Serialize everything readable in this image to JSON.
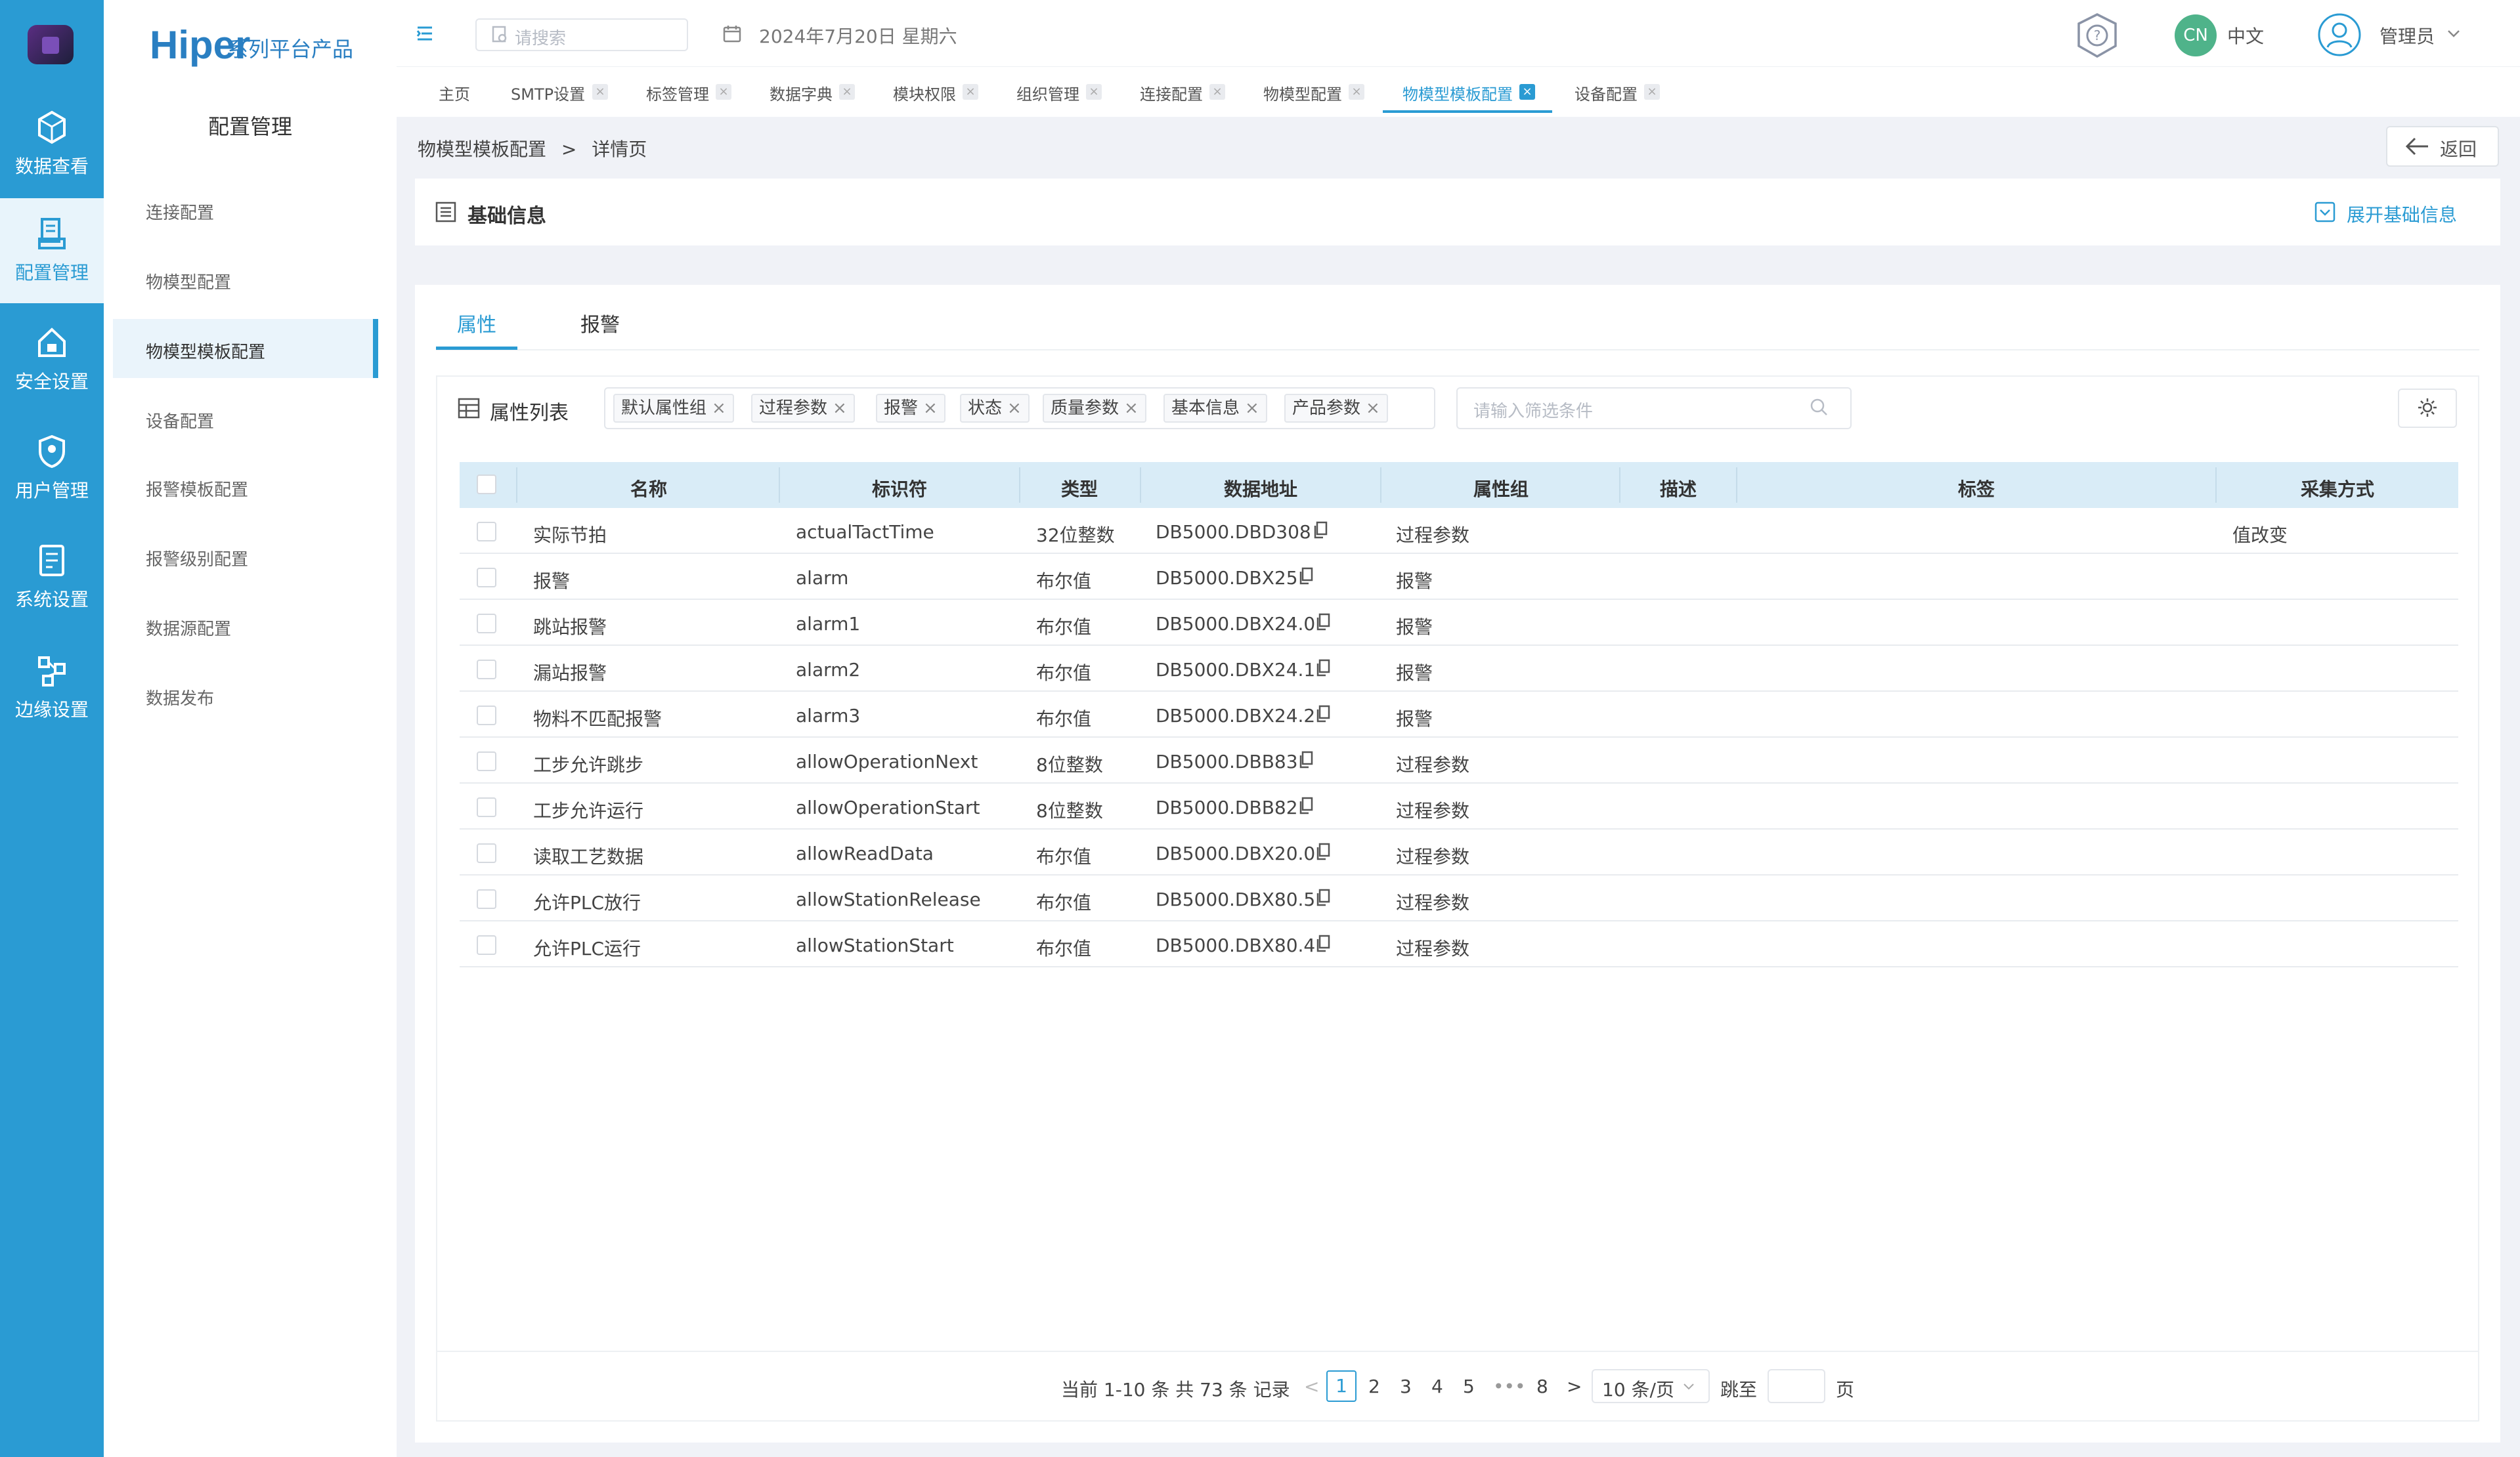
{
  "rail": {
    "items": [
      {
        "label": "数据查看",
        "icon": "cube-icon",
        "active": false
      },
      {
        "label": "配置管理",
        "icon": "config-icon",
        "active": true
      },
      {
        "label": "安全设置",
        "icon": "house-lock-icon",
        "active": false
      },
      {
        "label": "用户管理",
        "icon": "user-shield-icon",
        "active": false
      },
      {
        "label": "系统设置",
        "icon": "settings-doc-icon",
        "active": false
      },
      {
        "label": "边缘设置",
        "icon": "edge-nodes-icon",
        "active": false
      }
    ]
  },
  "brand": {
    "name": "Hiper",
    "suffix": "系列平台产品"
  },
  "sidebar": {
    "title": "配置管理",
    "items": [
      {
        "label": "连接配置"
      },
      {
        "label": "物模型配置"
      },
      {
        "label": "物模型模板配置",
        "active": true
      },
      {
        "label": "设备配置"
      },
      {
        "label": "报警模板配置"
      },
      {
        "label": "报警级别配置"
      },
      {
        "label": "数据源配置"
      },
      {
        "label": "数据发布"
      }
    ]
  },
  "header": {
    "search_placeholder": "请搜索",
    "date": "2024年7月20日 星期六",
    "lang_badge": "CN",
    "lang": "中文",
    "user": "管理员"
  },
  "tabs": [
    {
      "label": "主页",
      "closable": false
    },
    {
      "label": "SMTP设置",
      "closable": true
    },
    {
      "label": "标签管理",
      "closable": true
    },
    {
      "label": "数据字典",
      "closable": true
    },
    {
      "label": "模块权限",
      "closable": true
    },
    {
      "label": "组织管理",
      "closable": true
    },
    {
      "label": "连接配置",
      "closable": true
    },
    {
      "label": "物模型配置",
      "closable": true
    },
    {
      "label": "物模型模板配置",
      "closable": true,
      "active": true
    },
    {
      "label": "设备配置",
      "closable": true
    }
  ],
  "breadcrumb": {
    "parent": "物模型模板配置",
    "sep": ">",
    "current": "详情页"
  },
  "back_label": "返回",
  "basic": {
    "title": "基础信息",
    "expand_label": "展开基础信息"
  },
  "main_tabs": [
    {
      "label": "属性",
      "active": true
    },
    {
      "label": "报警",
      "active": false
    }
  ],
  "list": {
    "title": "属性列表",
    "filters": [
      "默认属性组",
      "过程参数",
      "报警",
      "状态",
      "质量参数",
      "基本信息",
      "产品参数"
    ],
    "condition_placeholder": "请输入筛选条件",
    "columns": [
      "名称",
      "标识符",
      "类型",
      "数据地址",
      "属性组",
      "描述",
      "标签",
      "采集方式"
    ],
    "rows": [
      {
        "name": "实际节拍",
        "id": "actualTactTime",
        "type": "32位整数",
        "addr": "DB5000.DBD308",
        "group": "过程参数",
        "desc": "",
        "tag": "",
        "mode": "值改变"
      },
      {
        "name": "报警",
        "id": "alarm",
        "type": "布尔值",
        "addr": "DB5000.DBX25",
        "group": "报警",
        "desc": "",
        "tag": "",
        "mode": ""
      },
      {
        "name": "跳站报警",
        "id": "alarm1",
        "type": "布尔值",
        "addr": "DB5000.DBX24.0",
        "group": "报警",
        "desc": "",
        "tag": "",
        "mode": ""
      },
      {
        "name": "漏站报警",
        "id": "alarm2",
        "type": "布尔值",
        "addr": "DB5000.DBX24.1",
        "group": "报警",
        "desc": "",
        "tag": "",
        "mode": ""
      },
      {
        "name": "物料不匹配报警",
        "id": "alarm3",
        "type": "布尔值",
        "addr": "DB5000.DBX24.2",
        "group": "报警",
        "desc": "",
        "tag": "",
        "mode": ""
      },
      {
        "name": "工步允许跳步",
        "id": "allowOperationNext",
        "type": "8位整数",
        "addr": "DB5000.DBB83",
        "group": "过程参数",
        "desc": "",
        "tag": "",
        "mode": ""
      },
      {
        "name": "工步允许运行",
        "id": "allowOperationStart",
        "type": "8位整数",
        "addr": "DB5000.DBB82",
        "group": "过程参数",
        "desc": "",
        "tag": "",
        "mode": ""
      },
      {
        "name": "读取工艺数据",
        "id": "allowReadData",
        "type": "布尔值",
        "addr": "DB5000.DBX20.0",
        "group": "过程参数",
        "desc": "",
        "tag": "",
        "mode": ""
      },
      {
        "name": "允许PLC放行",
        "id": "allowStationRelease",
        "type": "布尔值",
        "addr": "DB5000.DBX80.5",
        "group": "过程参数",
        "desc": "",
        "tag": "",
        "mode": ""
      },
      {
        "name": "允许PLC运行",
        "id": "allowStationStart",
        "type": "布尔值",
        "addr": "DB5000.DBX80.4",
        "group": "过程参数",
        "desc": "",
        "tag": "",
        "mode": ""
      }
    ]
  },
  "pagination": {
    "summary": "当前 1-10 条 共 73 条 记录",
    "prev": "<",
    "current": "1",
    "pages": [
      "2",
      "3",
      "4",
      "5"
    ],
    "ellipsis": "•••",
    "last": "8",
    "next": ">",
    "page_size": "10 条/页",
    "jump_label": "跳至",
    "page_unit": "页"
  },
  "colors": {
    "primary": "#2a9bd3",
    "rail": "#2a9bd3",
    "header_row": "#d9ecf7"
  }
}
